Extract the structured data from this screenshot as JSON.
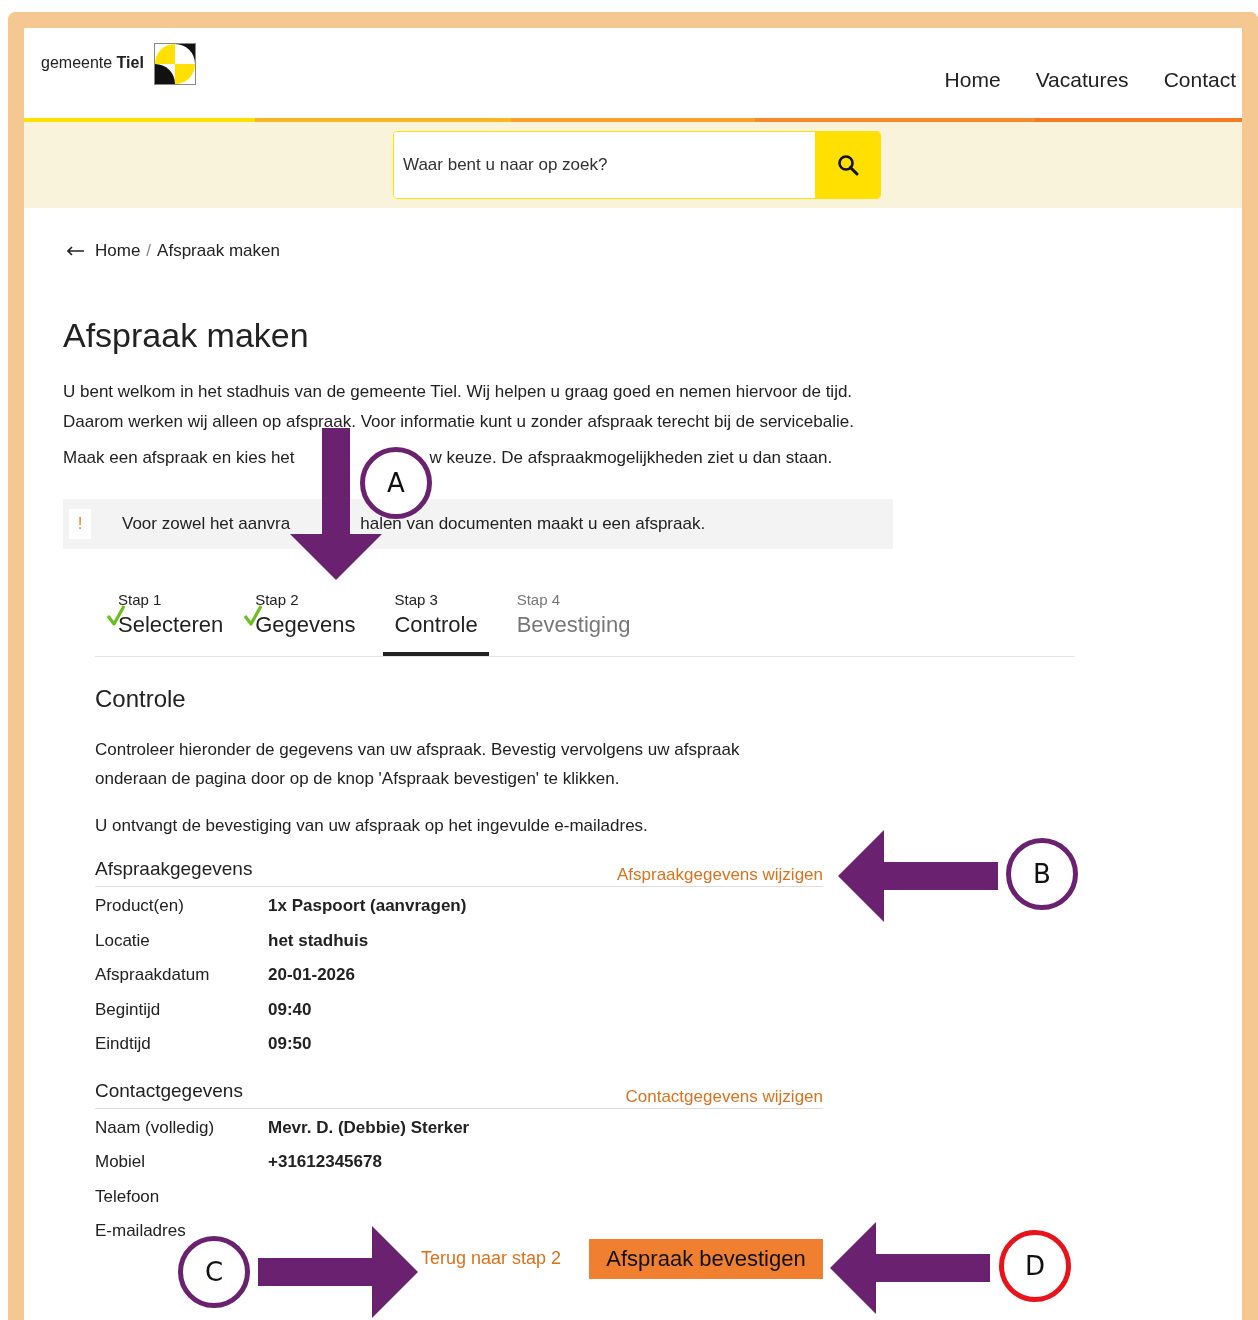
{
  "header": {
    "logo": {
      "prefix": "gemeente",
      "name": "Tiel"
    },
    "nav": [
      {
        "label": "Home"
      },
      {
        "label": "Vacatures"
      },
      {
        "label": "Contact"
      }
    ]
  },
  "search": {
    "placeholder": "Waar bent u naar op zoek?"
  },
  "breadcrumb": {
    "separator": "/",
    "items": [
      {
        "label": "Home"
      },
      {
        "label": "Afspraak maken"
      }
    ]
  },
  "title": "Afspraak maken",
  "intro": "U bent welkom in het stadhuis van de gemeente Tiel. Wij helpen u graag goed en nemen hiervoor de tijd. Daarom werken wij alleen op afspraak. Voor informatie kunt u zonder afspraak terecht bij de servicebalie.",
  "intro_partial": [
    "Maak een afspraak en kies het",
    "w keuze. De afspraakmogelijkheden ziet u dan staan."
  ],
  "notice": {
    "icon": "!",
    "text_parts": [
      "Voor zowel het aanvra",
      "halen van documenten maakt u een afspraak."
    ]
  },
  "steps": [
    {
      "step": "Stap 1",
      "label": "Selecteren",
      "done": true,
      "selected": false
    },
    {
      "step": "Stap 2",
      "label": "Gegevens",
      "done": true,
      "selected": false
    },
    {
      "step": "Stap 3",
      "label": "Controle",
      "done": false,
      "selected": true
    },
    {
      "step": "Stap 4",
      "label": "Bevestiging",
      "done": false,
      "selected": false
    }
  ],
  "section": {
    "title": "Controle",
    "paragraphs": [
      "Controleer hieronder de gegevens van uw afspraak. Bevestig vervolgens uw afspraak onderaan de pagina door op de knop 'Afspraak bevestigen' te klikken.",
      "U ontvangt de bevestiging van uw afspraak op het ingevulde e-mailadres."
    ]
  },
  "groups": [
    {
      "title": "Afspraakgegevens",
      "link": "Afspraakgegevens wijzigen",
      "rows": [
        {
          "label": "Product(en)",
          "value": "1x Paspoort (aanvragen)"
        },
        {
          "label": "Locatie",
          "value": "het stadhuis"
        },
        {
          "label": "Afspraakdatum",
          "value": "20-01-2026"
        },
        {
          "label": "Begintijd",
          "value": "09:40"
        },
        {
          "label": "Eindtijd",
          "value": "09:50"
        }
      ]
    },
    {
      "title": "Contactgegevens",
      "link": "Contactgegevens wijzigen",
      "rows": [
        {
          "label": "Naam (volledig)",
          "value": "Mevr. D. (Debbie) Sterker"
        },
        {
          "label": "Mobiel",
          "value": "+31612345678"
        },
        {
          "label": "Telefoon"
        },
        {
          "label": "E-mailadres"
        }
      ]
    }
  ],
  "actions": {
    "back": "Terug naar stap 2",
    "confirm": "Afspraak bevestigen"
  },
  "annotations": [
    {
      "letter": "A",
      "color": "#6a2270",
      "kind": "down"
    },
    {
      "letter": "B",
      "color": "#6a2270",
      "kind": "left"
    },
    {
      "letter": "C",
      "color": "#6a2270",
      "kind": "right"
    },
    {
      "letter": "D",
      "color": "#e8141c",
      "kind": "left"
    }
  ]
}
